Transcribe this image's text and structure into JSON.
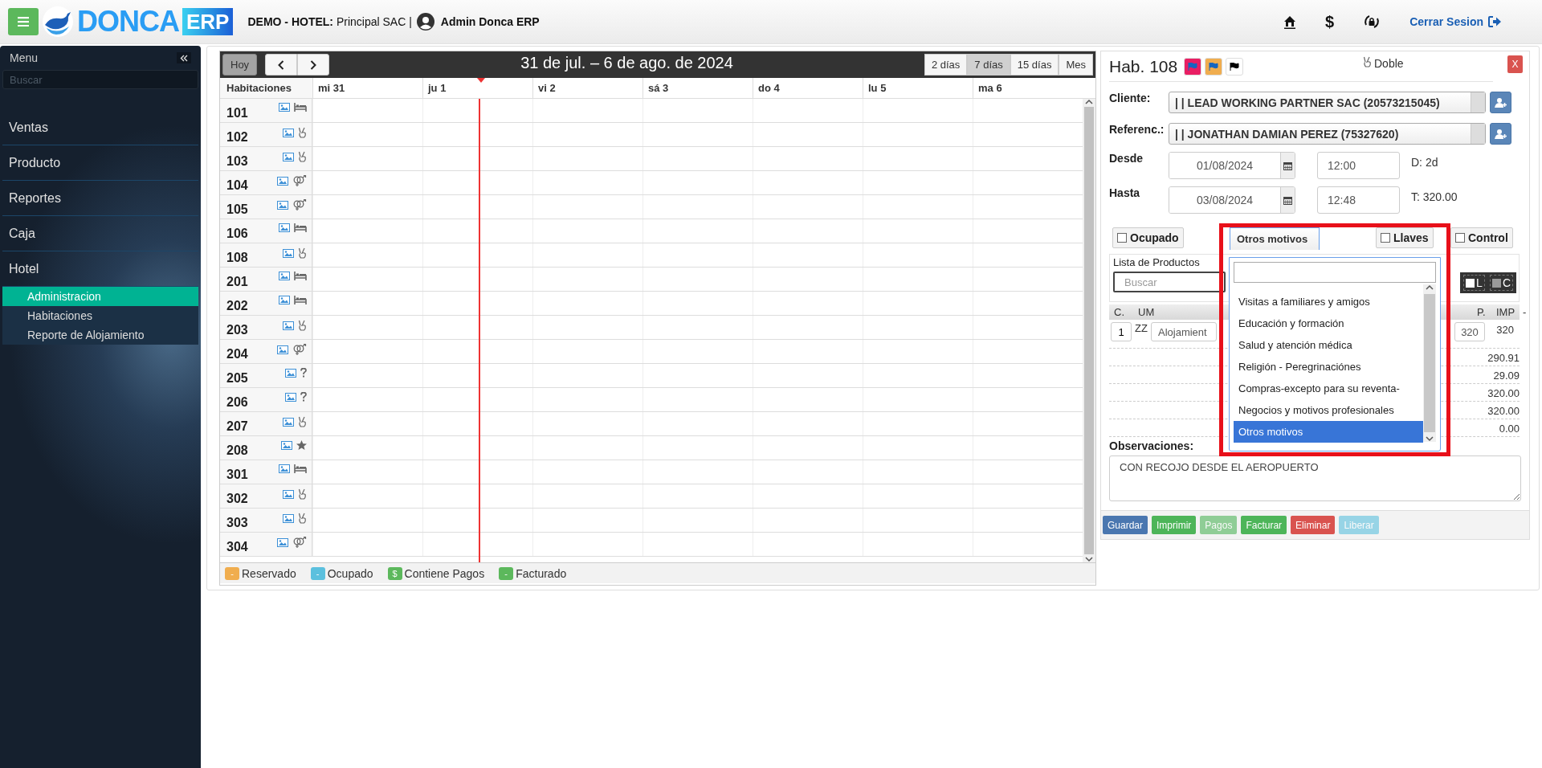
{
  "topbar": {
    "brand": "DONCA",
    "brand_badge": "ERP",
    "company": "**DEMO - HOTEL:** Principal SAC |",
    "user": "Admin Donca ERP",
    "currency_icon": "$",
    "logout": "Cerrar Sesion"
  },
  "sidebar": {
    "title": "Menu",
    "search": {
      "placeholder": "Buscar"
    },
    "items": [
      {
        "label": "Ventas"
      },
      {
        "label": "Producto"
      },
      {
        "label": "Reportes"
      },
      {
        "label": "Caja"
      },
      {
        "label": "Hotel",
        "children": [
          {
            "label": "Administracion",
            "selected": true
          },
          {
            "label": "Habitaciones",
            "selected": false
          },
          {
            "label": "Reporte de Alojamiento",
            "selected": false
          }
        ]
      }
    ]
  },
  "calendar": {
    "today_button": "Hoy",
    "title": "31 de jul. – 6 de ago. de 2024",
    "views": [
      {
        "label": "2 días",
        "selected": false
      },
      {
        "label": "7 días",
        "selected": true
      },
      {
        "label": "15 días",
        "selected": false
      },
      {
        "label": "Mes",
        "selected": false
      }
    ],
    "rooms_header": "Habitaciones",
    "days": [
      "mi 31",
      "ju 1",
      "vi 2",
      "sá 3",
      "do 4",
      "lu 5",
      "ma 6"
    ],
    "rooms": [
      {
        "number": "101",
        "kind": "bed"
      },
      {
        "number": "102",
        "kind": "hand"
      },
      {
        "number": "103",
        "kind": "hand"
      },
      {
        "number": "104",
        "kind": "couple"
      },
      {
        "number": "105",
        "kind": "couple"
      },
      {
        "number": "106",
        "kind": "bed"
      },
      {
        "number": "108",
        "kind": "hand"
      },
      {
        "number": "201",
        "kind": "bed"
      },
      {
        "number": "202",
        "kind": "bed"
      },
      {
        "number": "203",
        "kind": "hand"
      },
      {
        "number": "204",
        "kind": "couple"
      },
      {
        "number": "205",
        "kind": "unknown"
      },
      {
        "number": "206",
        "kind": "unknown"
      },
      {
        "number": "207",
        "kind": "hand"
      },
      {
        "number": "208",
        "kind": "star"
      },
      {
        "number": "301",
        "kind": "bed"
      },
      {
        "number": "302",
        "kind": "hand"
      },
      {
        "number": "303",
        "kind": "hand"
      },
      {
        "number": "304",
        "kind": "couple"
      }
    ],
    "legend": [
      {
        "symbol": "-",
        "label": "Reservado",
        "color": "#f0ad4e"
      },
      {
        "symbol": "-",
        "label": "Ocupado",
        "color": "#5bc0de"
      },
      {
        "symbol": "$",
        "label": "Contiene Pagos",
        "color": "#5cb85c"
      },
      {
        "symbol": "-",
        "label": "Facturado",
        "color": "#5cb85c"
      }
    ]
  },
  "booking": {
    "title": "Hab. 108",
    "flags": [
      {
        "color": "#e91e63"
      },
      {
        "color": "#f0ad4e"
      },
      {
        "color": "#ffffff"
      }
    ],
    "room_type": "Doble",
    "close": "X",
    "client": {
      "label": "Cliente:",
      "value": "| | LEAD WORKING PARTNER SAC (20573215045)"
    },
    "reference": {
      "label": "Referenc.:",
      "value": "| | JONATHAN DAMIAN PEREZ (75327620)"
    },
    "from": {
      "label": "Desde",
      "date": "01/08/2024",
      "time": "12:00",
      "info": "D: 2d"
    },
    "to": {
      "label": "Hasta",
      "date": "03/08/2024",
      "time": "12:48",
      "info": "T: 320.00"
    },
    "occupied": {
      "label": "Ocupado",
      "checked": false
    },
    "reason_select": {
      "value": "Otros motivos",
      "expanded": true,
      "options": [
        {
          "label": "Visitas a familiares y amigos",
          "selected": false
        },
        {
          "label": "Educación y formación",
          "selected": false
        },
        {
          "label": "Salud y atención médica",
          "selected": false
        },
        {
          "label": "Religión - Peregrinaciónes",
          "selected": false
        },
        {
          "label": "Compras-excepto para su reventa-",
          "selected": false
        },
        {
          "label": "Negocios y motivos profesionales",
          "selected": false
        },
        {
          "label": "Otros motivos",
          "selected": true
        }
      ]
    },
    "keys": {
      "label": "Llaves",
      "checked": false
    },
    "control": {
      "label": "Control",
      "checked": false
    },
    "products": {
      "title": "Lista de Productos",
      "search": {
        "placeholder": "Buscar"
      },
      "toggles": [
        {
          "label": "L",
          "checked": false,
          "disabled": false
        },
        {
          "label": "C",
          "disabled": true
        }
      ],
      "columns": [
        "C.",
        "UM",
        "P.",
        "IMP",
        "-"
      ],
      "row": {
        "qty": "1",
        "unit": "ZZ",
        "description": "Alojamient",
        "price": "320",
        "amount": "320"
      },
      "totals": [
        "290.91",
        "29.09",
        "320.00",
        "320.00",
        "0.00"
      ]
    },
    "notes": {
      "label": "Observaciones:",
      "value": "CON RECOJO DESDE EL AEROPUERTO"
    },
    "actions": [
      {
        "label": "Guardar",
        "kind": "primary",
        "disabled": false
      },
      {
        "label": "Imprimir",
        "kind": "success",
        "disabled": false
      },
      {
        "label": "Pagos",
        "kind": "success",
        "disabled": true
      },
      {
        "label": "Facturar",
        "kind": "success",
        "disabled": false
      },
      {
        "label": "Eliminar",
        "kind": "danger",
        "disabled": false
      },
      {
        "label": "Liberar",
        "kind": "info",
        "disabled": true
      }
    ]
  }
}
